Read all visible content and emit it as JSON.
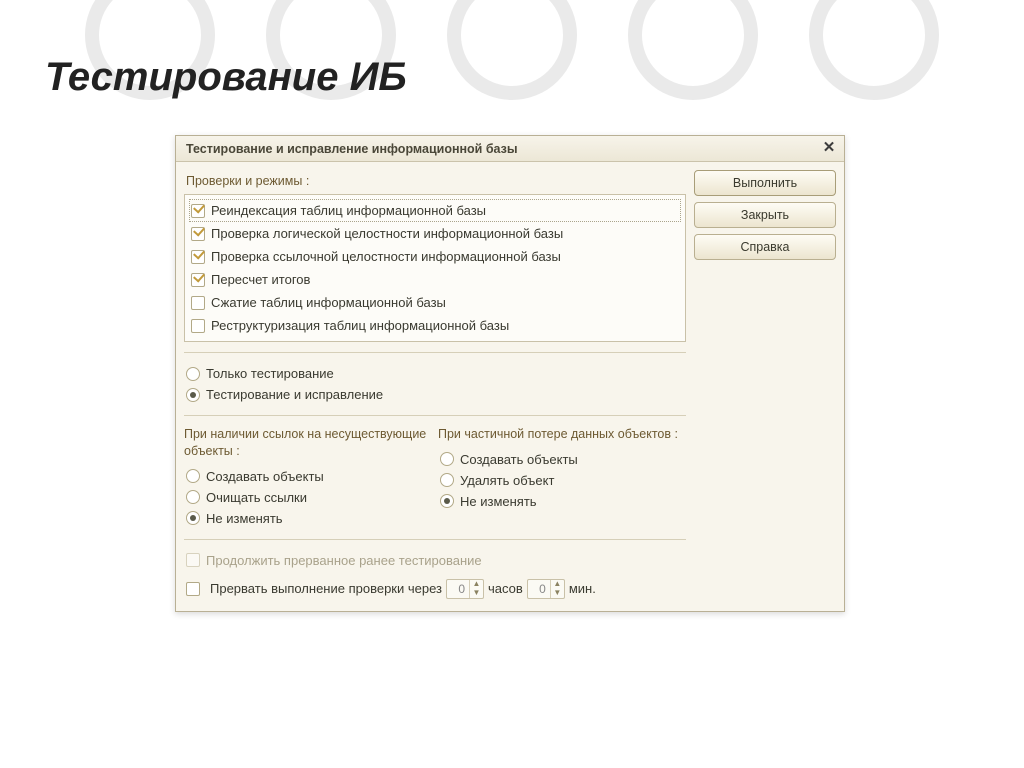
{
  "page": {
    "title": "Тестирование ИБ"
  },
  "dialog": {
    "title": "Тестирование и исправление информационной базы"
  },
  "buttons": {
    "execute": "Выполнить",
    "close": "Закрыть",
    "help": "Справка"
  },
  "checks": {
    "label": "Проверки и режимы :",
    "items": [
      {
        "label": "Реиндексация таблиц информационной базы",
        "checked": true,
        "focused": true
      },
      {
        "label": "Проверка логической целостности информационной базы",
        "checked": true
      },
      {
        "label": "Проверка ссылочной целостности информационной базы",
        "checked": true
      },
      {
        "label": "Пересчет итогов",
        "checked": true
      },
      {
        "label": "Сжатие таблиц информационной базы",
        "checked": false
      },
      {
        "label": "Реструктуризация таблиц информационной базы",
        "checked": false
      }
    ]
  },
  "mode": {
    "test_only": "Только тестирование",
    "test_and_fix": "Тестирование и исправление"
  },
  "missing_refs": {
    "label": "При наличии ссылок на несуществующие объекты :",
    "create": "Создавать объекты",
    "clear": "Очищать ссылки",
    "keep": "Не изменять"
  },
  "partial_loss": {
    "label": "При частичной потере данных объектов :",
    "create": "Создавать объекты",
    "delete": "Удалять объект",
    "keep": "Не изменять"
  },
  "resume": {
    "label": "Продолжить прерванное ранее тестирование"
  },
  "interrupt": {
    "label": "Прервать выполнение проверки через",
    "hours": "0",
    "hours_unit": "часов",
    "minutes": "0",
    "minutes_unit": "мин."
  }
}
